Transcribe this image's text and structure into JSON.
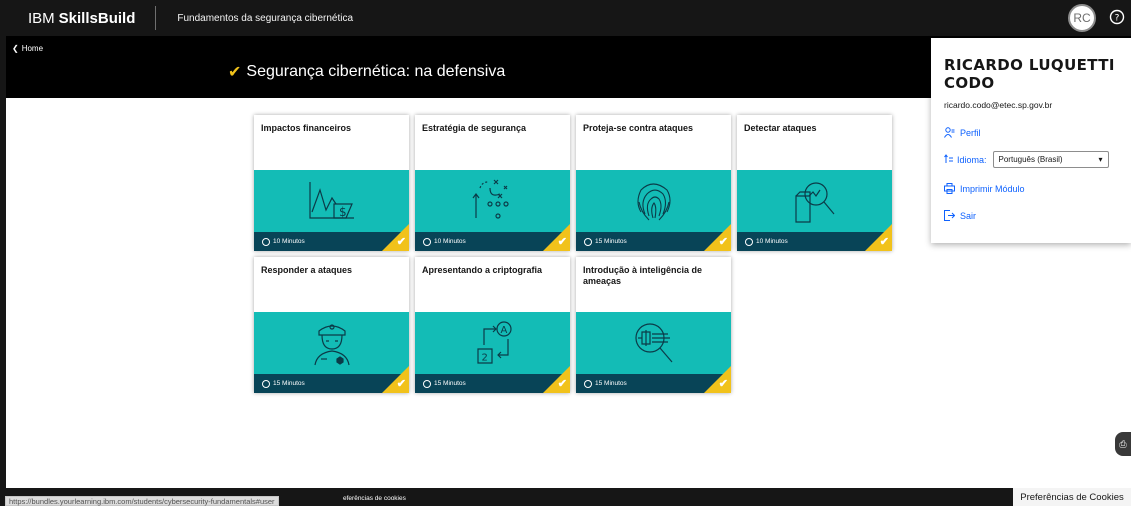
{
  "header": {
    "brand_ibm": "IBM",
    "brand_skills": "SkillsBuild",
    "course_name": "Fundamentos da segurança cibernética",
    "avatar_initials": "RC",
    "help_icon": "help-circle-icon"
  },
  "hero": {
    "home_label": "Home",
    "title": "Segurança cibernética: na defensiva",
    "status_color": "#f1c21b"
  },
  "cards": [
    {
      "title": "Impactos financeiros",
      "duration": "10 Minutos",
      "icon": "financial-chart-icon"
    },
    {
      "title": "Estratégia de segurança",
      "duration": "10 Minutos",
      "icon": "strategy-play-icon"
    },
    {
      "title": "Proteja-se contra ataques",
      "duration": "15 Minutos",
      "icon": "fingerprint-icon"
    },
    {
      "title": "Detectar ataques",
      "duration": "10 Minutos",
      "icon": "magnifier-document-icon"
    },
    {
      "title": "Responder a ataques",
      "duration": "15 Minutos",
      "icon": "security-guard-icon"
    },
    {
      "title": "Apresentando a criptografia",
      "duration": "15 Minutos",
      "icon": "encryption-icon"
    },
    {
      "title": "Introdução à inteligência de ameaças",
      "duration": "15 Minutos",
      "icon": "threat-intel-icon"
    }
  ],
  "profile_menu": {
    "name": "RICARDO LUQUETTI CODO",
    "email": "ricardo.codo@etec.sp.gov.br",
    "profile_label": "Perfil",
    "language_label": "Idioma:",
    "language_value": "Português (Brasil)",
    "print_label": "Imprimir Módulo",
    "logout_label": "Sair"
  },
  "footer": {
    "status_url": "https://bundles.yourlearning.ibm.com/students/cybersecurity-fundamentals#user",
    "cookie_link": "eferências de cookies",
    "cookie_button": "Preferências de Cookies"
  },
  "colors": {
    "accent_teal": "#13bcb6",
    "footer_navy": "#084457",
    "link_blue": "#0f62fe",
    "complete_yellow": "#f1c21b"
  }
}
